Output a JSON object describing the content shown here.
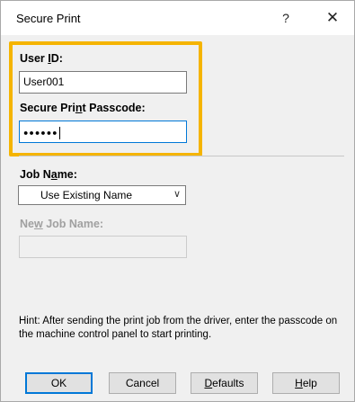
{
  "window": {
    "title": "Secure Print",
    "help_glyph": "?",
    "close_glyph": "✕"
  },
  "credentials": {
    "highlight_color": "#f5b400",
    "user_id_label_pre": "User ",
    "user_id_label_mnemonic": "I",
    "user_id_label_post": "D:",
    "user_id_value": "User001",
    "passcode_label_pre": "Secure Pri",
    "passcode_label_mnemonic": "n",
    "passcode_label_post": "t Passcode:",
    "passcode_masked": "●●●●●●"
  },
  "job": {
    "job_name_label_pre": "Job N",
    "job_name_label_mnemonic": "a",
    "job_name_label_post": "me:",
    "job_name_selected": "Use Existing Name",
    "new_job_name_label_pre": "Ne",
    "new_job_name_label_mnemonic": "w",
    "new_job_name_label_post": " Job Name:",
    "new_job_name_value": ""
  },
  "hint": "Hint: After sending the print job from the driver, enter the passcode on the machine control panel to start printing.",
  "buttons": {
    "ok": "OK",
    "cancel": "Cancel",
    "defaults_mnemonic": "D",
    "defaults_rest": "efaults",
    "help_mnemonic": "H",
    "help_rest": "elp"
  }
}
